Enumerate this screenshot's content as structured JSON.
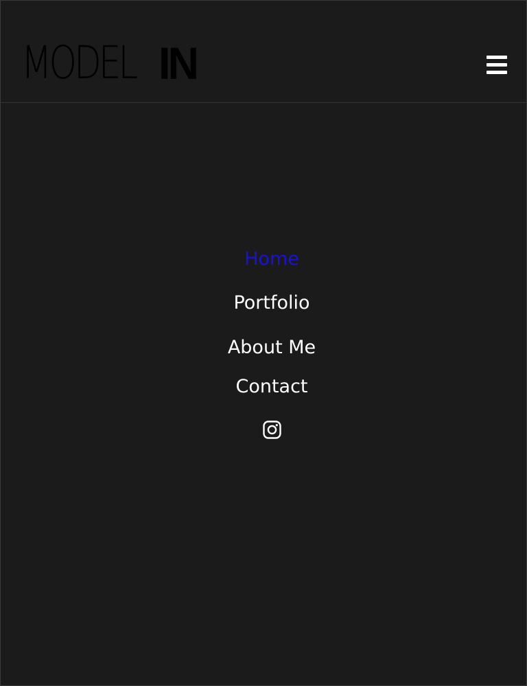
{
  "header": {
    "logo_thin": "MODEL",
    "logo_bold": "IN",
    "menu_icon": "hamburger-menu-icon"
  },
  "nav": {
    "items": [
      {
        "label": "Home",
        "active": true
      },
      {
        "label": "Portfolio",
        "active": false
      },
      {
        "label": "About Me",
        "active": false
      },
      {
        "label": "Contact",
        "active": false
      }
    ],
    "social_icon": "instagram-icon"
  },
  "colors": {
    "background": "#1b1b1b",
    "active_link": "#1a12d6",
    "link": "#ffffff",
    "logo": "#000000"
  }
}
